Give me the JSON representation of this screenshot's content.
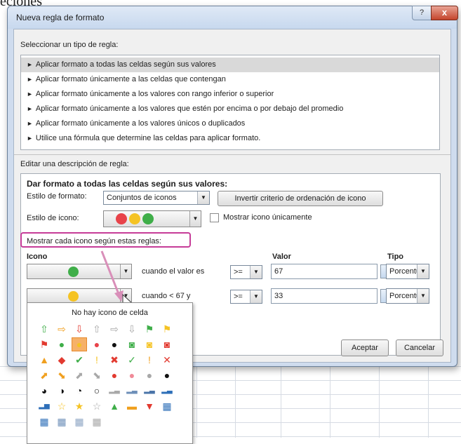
{
  "page_top_text": "eciones",
  "dialog": {
    "title": "Nueva regla de formato",
    "help_glyph": "?",
    "close_glyph": "x",
    "select_type_label": "Seleccionar un tipo de regla:",
    "rule_types": [
      "Aplicar formato a todas las celdas según sus valores",
      "Aplicar formato únicamente a las celdas que contengan",
      "Aplicar formato únicamente a los valores con rango inferior o superior",
      "Aplicar formato únicamente a los valores que estén por encima o por debajo del promedio",
      "Aplicar formato únicamente a los valores únicos o duplicados",
      "Utilice una fórmula que determine las celdas para aplicar formato."
    ],
    "selected_rule_index": 0,
    "edit_description_label": "Editar una descripción de regla:",
    "edit": {
      "heading": "Dar formato a todas las celdas según sus valores:",
      "format_style_label": "Estilo de formato:",
      "format_style_value": "Conjuntos de iconos",
      "reverse_button": "Invertir criterio de ordenación de icono",
      "icon_style_label": "Estilo de icono:",
      "icon_style_colors": [
        "#e8434a",
        "#f5c324",
        "#3fae49"
      ],
      "show_icon_only_label": "Mostrar icono únicamente",
      "show_icon_only_checked": false,
      "rules_label": "Mostrar cada icono según estas reglas:",
      "col_icon": "Icono",
      "col_value": "Valor",
      "col_type": "Tipo",
      "rows": [
        {
          "icon_color": "#3fae49",
          "condition": "cuando el valor es",
          "operator": ">=",
          "value": "67",
          "type": "Porcentual"
        },
        {
          "icon_color": "#f5c324",
          "condition": "cuando < 67 y",
          "operator": ">=",
          "value": "33",
          "type": "Porcentual"
        }
      ]
    },
    "ok_button": "Aceptar",
    "cancel_button": "Cancelar"
  },
  "icon_popup": {
    "no_icon_label": "No hay icono de celda",
    "rows": [
      [
        "⇧",
        "⇨",
        "⇩",
        "⇧",
        "⇨",
        "⇩",
        "⚑",
        "⚑"
      ],
      [
        "⚑",
        "●",
        "●",
        "●",
        "●",
        "◙",
        "◙",
        "◙"
      ],
      [
        "▲",
        "◆",
        "✔",
        "!",
        "✖",
        "✓",
        "!",
        "✕"
      ],
      [
        "⬈",
        "⬊",
        "⬈",
        "⬊",
        "●",
        "●",
        "●",
        "●"
      ],
      [
        "◕",
        "◑",
        "◔",
        "○",
        "▂▃",
        "▂▃",
        "▂▃",
        "▂▃"
      ],
      [
        "▂▅",
        "☆",
        "★",
        "☆",
        "▲",
        "▬",
        "▼",
        "▦"
      ],
      [
        "▦",
        "▦",
        "▦",
        "▦"
      ]
    ],
    "selected_cell": [
      1,
      2
    ],
    "colors": {
      "green": "#3fae49",
      "yellow": "#f5c324",
      "red": "#e23a30",
      "pink": "#f08a98",
      "orange": "#f0a020",
      "gray": "#a8a8a8",
      "black": "#111111",
      "blue": "#2e6fb8"
    }
  },
  "colors": {
    "highlight": "#c63c98",
    "dialog_frame": "#cfdcee",
    "selection": "#d9d9d9"
  }
}
